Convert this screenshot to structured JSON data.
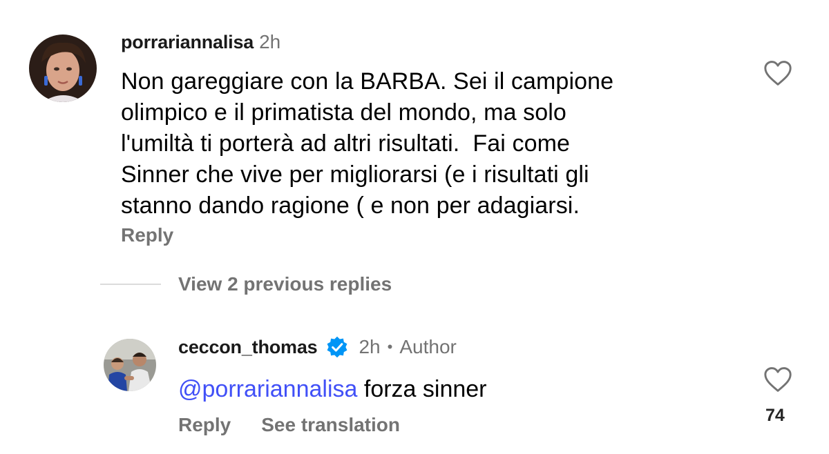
{
  "comment": {
    "username": "porrariannalisa",
    "time": "2h",
    "lines": [
      "Non gareggiare con la BARBA. Sei il campione",
      "olimpico e il primatista del mondo, ma solo",
      "l'umiltà ti porterà ad altri risultati.  Fai come",
      "Sinner che vive per migliorarsi (e i risultati gli",
      "stanno dando ragione ( e non per adagiarsi."
    ],
    "reply_label": "Reply"
  },
  "view_replies": "View 2 previous replies",
  "reply": {
    "username": "ceccon_thomas",
    "time": "2h",
    "separator": "•",
    "author_tag": "Author",
    "mention": "@porrariannalisa",
    "text": " forza sinner",
    "reply_label": "Reply",
    "translate_label": "See translation",
    "likes": "74"
  },
  "colors": {
    "muted": "#737373",
    "mention": "#4150f7",
    "verified": "#0095f6"
  }
}
